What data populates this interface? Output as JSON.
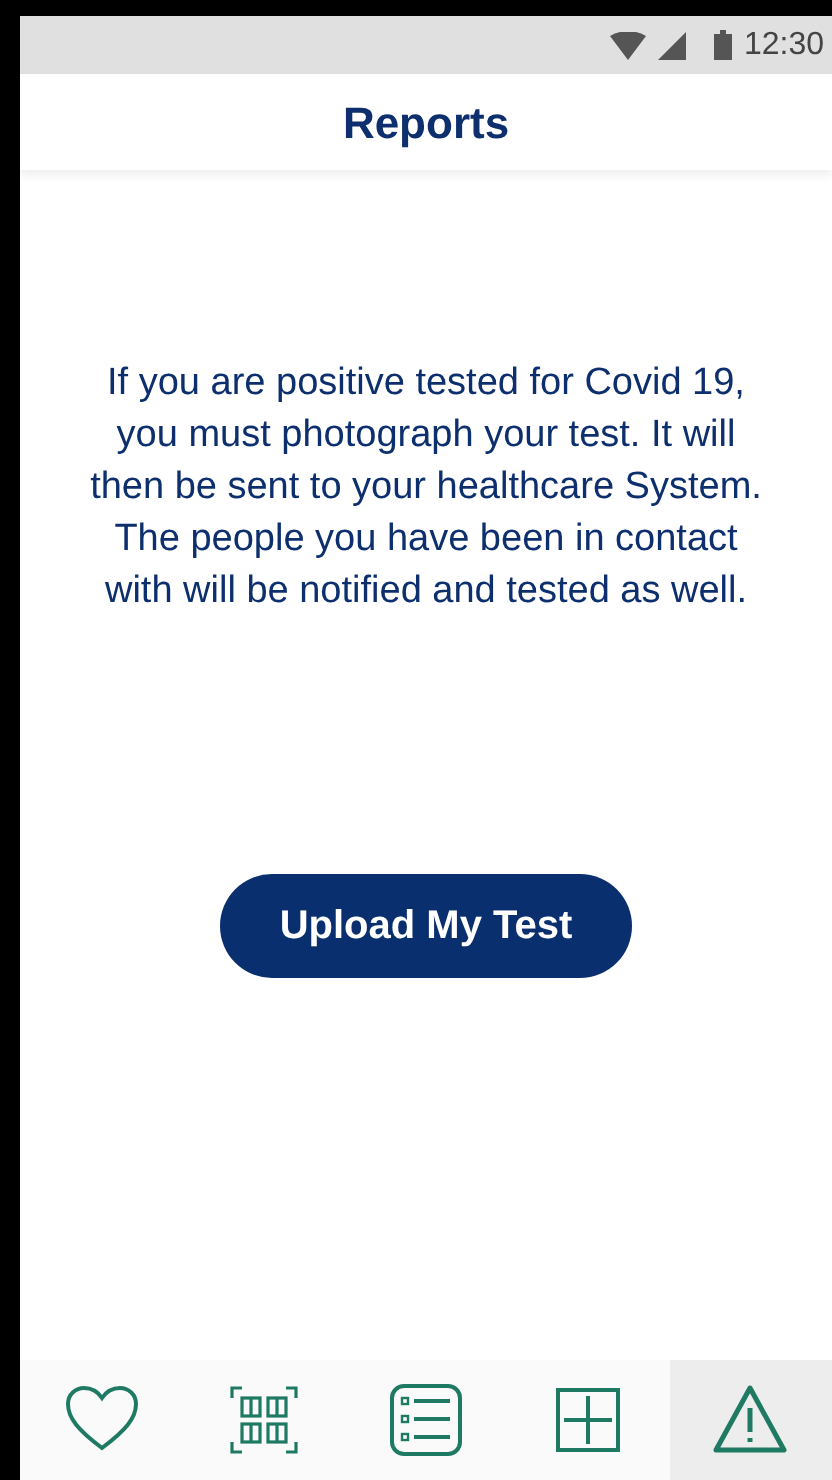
{
  "status_bar": {
    "time": "12:30"
  },
  "header": {
    "title": "Reports"
  },
  "message": "If you are positive tested for Covid 19,\nyou must photograph your test. It will then be sent to your healthcare System. The people you have been in contact with will be notified and tested as well.",
  "upload_button": {
    "label": "Upload My Test"
  },
  "nav": [
    {
      "kind": "heart",
      "selected": false
    },
    {
      "kind": "qr",
      "selected": false
    },
    {
      "kind": "list",
      "selected": false
    },
    {
      "kind": "plus",
      "selected": false
    },
    {
      "kind": "warning",
      "selected": true
    }
  ]
}
